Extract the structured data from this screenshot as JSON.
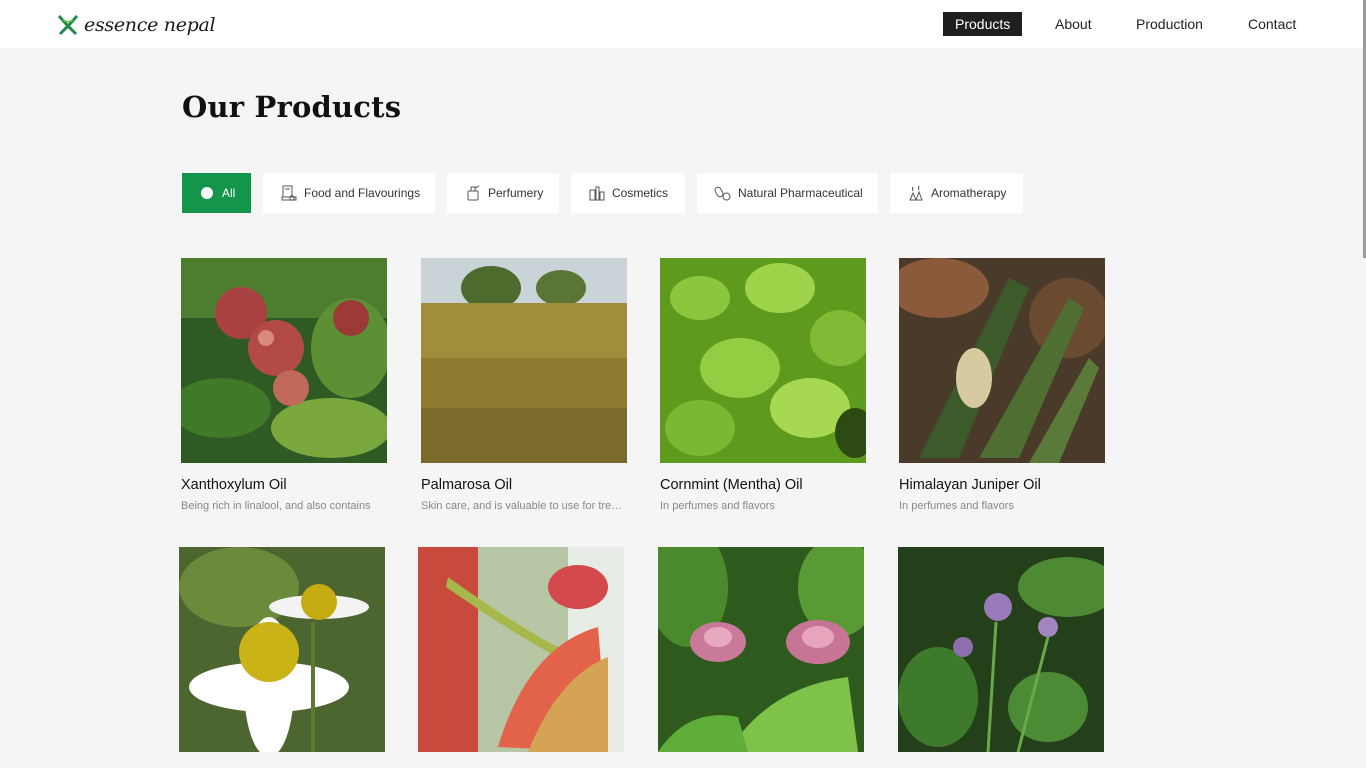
{
  "brand": {
    "logo_text": "essence nepal"
  },
  "nav": [
    {
      "label": "Products",
      "active": true
    },
    {
      "label": "About"
    },
    {
      "label": "Production"
    },
    {
      "label": "Contact"
    }
  ],
  "page": {
    "title": "Our Products"
  },
  "filters": [
    {
      "label": "All",
      "icon": "dot-icon",
      "active": true
    },
    {
      "label": "Food and Flavourings",
      "icon": "food-icon"
    },
    {
      "label": "Perfumery",
      "icon": "perfume-icon"
    },
    {
      "label": "Cosmetics",
      "icon": "cosmetics-icon"
    },
    {
      "label": "Natural Pharmaceutical",
      "icon": "pills-icon"
    },
    {
      "label": "Aromatherapy",
      "icon": "aromatherapy-icon"
    }
  ],
  "products": [
    {
      "name": "Xanthoxylum Oil",
      "desc": "Being rich in linalool, and also contains",
      "image": "red-berries"
    },
    {
      "name": "Palmarosa Oil",
      "desc": "Skin care, and is valuable to use for treating",
      "image": "grass-field"
    },
    {
      "name": "Cornmint (Mentha) Oil",
      "desc": "In perfumes and flavors",
      "image": "green-leaves"
    },
    {
      "name": "Himalayan Juniper Oil",
      "desc": "In perfumes and flavors",
      "image": "juniper-branch"
    },
    {
      "name": "",
      "desc": "",
      "image": "chamomile-flower"
    },
    {
      "name": "",
      "desc": "",
      "image": "red-bud"
    },
    {
      "name": "",
      "desc": "",
      "image": "turmeric-flower"
    },
    {
      "name": "",
      "desc": "",
      "image": "purple-flowers"
    }
  ],
  "colors": {
    "accent": "#13964b",
    "nav_active_bg": "#1f1f1f",
    "page_bg": "#f5f5f5"
  }
}
